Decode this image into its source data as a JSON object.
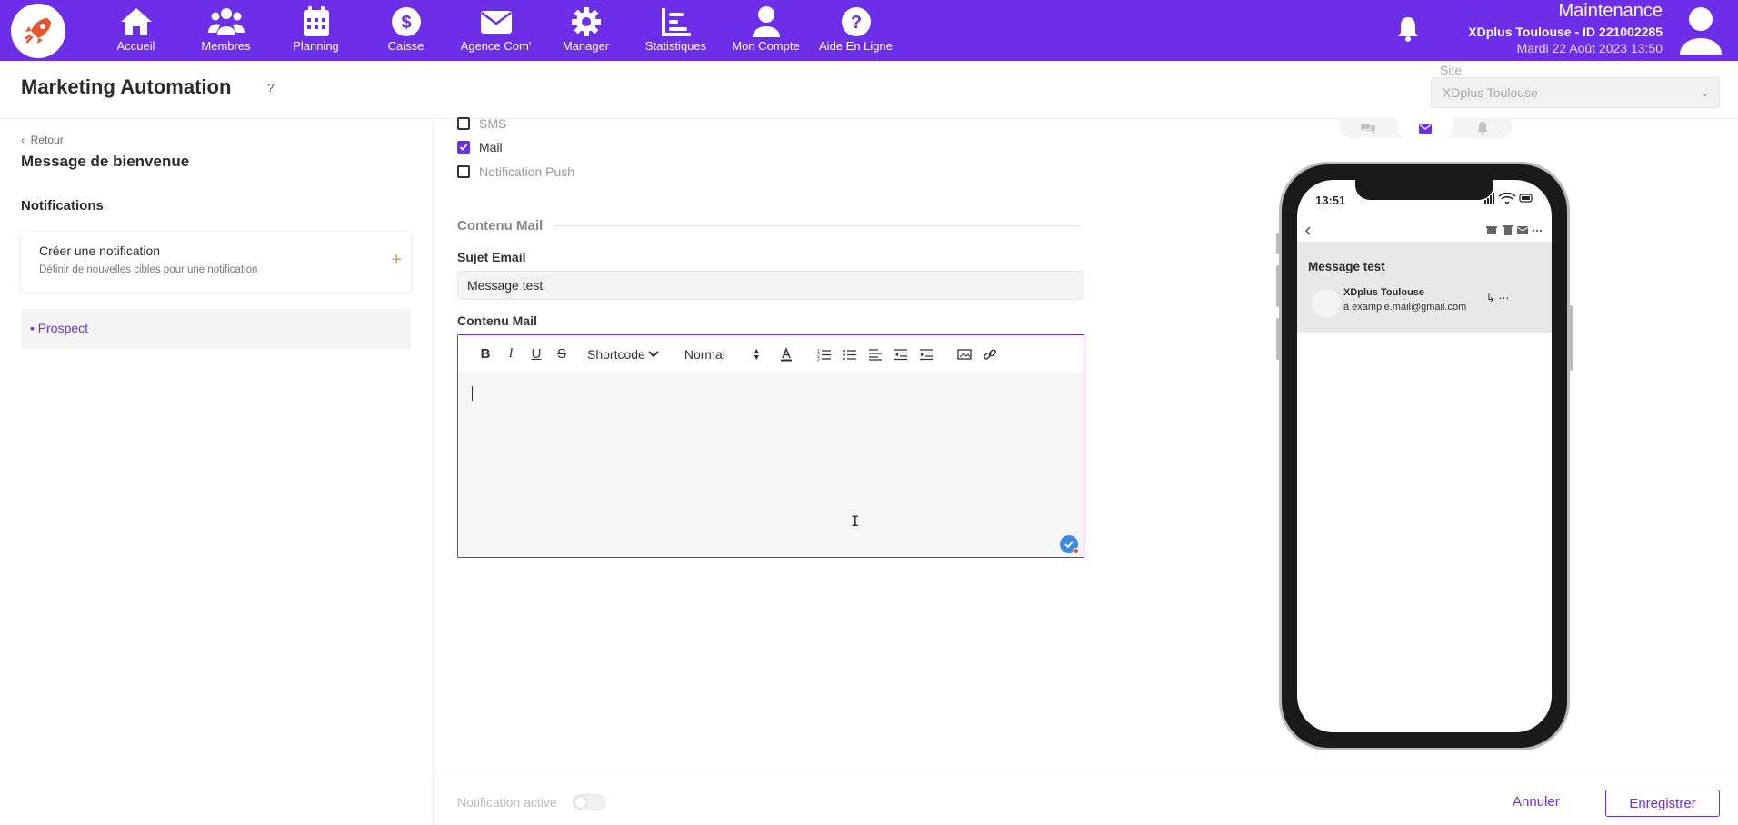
{
  "nav": {
    "items": [
      {
        "label": "Accueil",
        "icon": "home-icon"
      },
      {
        "label": "Membres",
        "icon": "users-icon"
      },
      {
        "label": "Planning",
        "icon": "calendar-icon"
      },
      {
        "label": "Caisse",
        "icon": "dollar-icon"
      },
      {
        "label": "Agence Com'",
        "icon": "envelope-icon"
      },
      {
        "label": "Manager",
        "icon": "gear-icon"
      },
      {
        "label": "Statistiques",
        "icon": "chart-icon"
      },
      {
        "label": "Mon Compte",
        "icon": "user-icon"
      },
      {
        "label": "Aide En Ligne",
        "icon": "help-icon"
      }
    ]
  },
  "user": {
    "mode": "Maintenance",
    "site_id": "XDplus Toulouse - ID 221002285",
    "datetime": "Mardi 22 Août 2023 13:50"
  },
  "header": {
    "title": "Marketing Automation",
    "help": "?",
    "site_label": "Site",
    "site_value": "XDplus Toulouse"
  },
  "sidebar": {
    "back": "Retour",
    "message_title": "Message de bienvenue",
    "notifications_heading": "Notifications",
    "create_title": "Créer une notification",
    "create_subtitle": "Définir de nouvelles cibles pour une notification",
    "create_plus": "+",
    "prospect": "• Prospect"
  },
  "channels": {
    "sms": "SMS",
    "mail": "Mail",
    "push": "Notification Push",
    "mail_checked": true
  },
  "form": {
    "section": "Contenu Mail",
    "subject_label": "Sujet Email",
    "subject_value": "Message test",
    "content_label": "Contenu Mail",
    "shortcode": "Shortcode",
    "size": "Normal"
  },
  "phone": {
    "time": "13:51",
    "subject": "Message test",
    "sender": "XDplus Toulouse",
    "recipient": "à example.mail@gmail.com"
  },
  "footer": {
    "active_label": "Notification active",
    "cancel": "Annuler",
    "save": "Enregistrer"
  },
  "colors": {
    "brand": "#6c2ee6",
    "accent_plus": "#c8a35a"
  }
}
